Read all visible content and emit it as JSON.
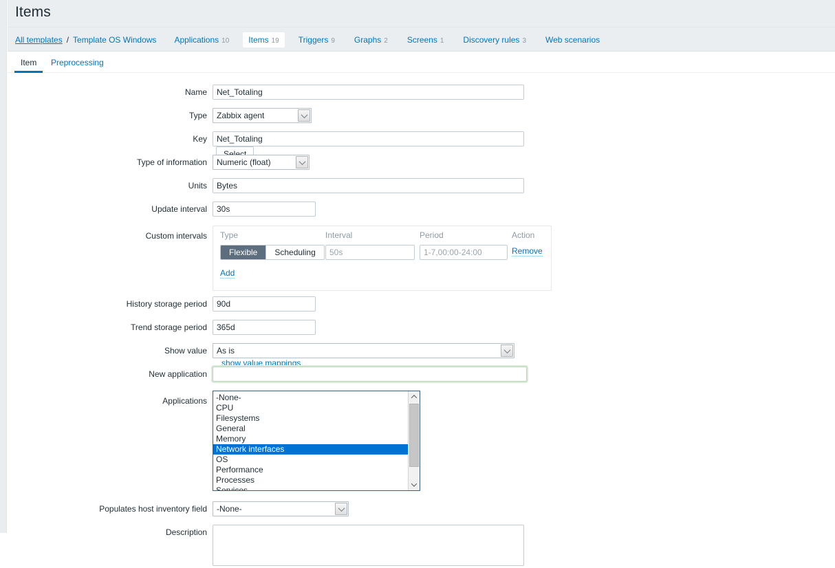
{
  "header": {
    "title": "Items"
  },
  "breadcrumb": {
    "all_templates": "All templates",
    "separator": "/",
    "template": "Template OS Windows"
  },
  "object_tabs": [
    {
      "label": "Applications",
      "count": "10",
      "active": false
    },
    {
      "label": "Items",
      "count": "19",
      "active": true
    },
    {
      "label": "Triggers",
      "count": "9",
      "active": false
    },
    {
      "label": "Graphs",
      "count": "2",
      "active": false
    },
    {
      "label": "Screens",
      "count": "1",
      "active": false
    },
    {
      "label": "Discovery rules",
      "count": "3",
      "active": false
    },
    {
      "label": "Web scenarios",
      "count": "",
      "active": false
    }
  ],
  "form_tabs": {
    "item": "Item",
    "preprocessing": "Preprocessing"
  },
  "labels": {
    "name": "Name",
    "type": "Type",
    "key": "Key",
    "type_of_information": "Type of information",
    "units": "Units",
    "update_interval": "Update interval",
    "custom_intervals": "Custom intervals",
    "history_storage_period": "History storage period",
    "trend_storage_period": "Trend storage period",
    "show_value": "Show value",
    "new_application": "New application",
    "applications": "Applications",
    "populates_host_inventory_field": "Populates host inventory field",
    "description": "Description"
  },
  "fields": {
    "name": "Net_Totaling",
    "type": "Zabbix agent",
    "key": "Net_Totaling",
    "key_select_button": "Select",
    "type_of_information": "Numeric (float)",
    "units": "Bytes",
    "update_interval": "30s",
    "history_storage_period": "90d",
    "trend_storage_period": "365d",
    "show_value": "As is",
    "show_value_mappings_link": "show value mappings",
    "new_application": "",
    "new_application_placeholder": "",
    "populates_host_inventory_field": "-None-",
    "description": ""
  },
  "custom_intervals": {
    "columns": {
      "type": "Type",
      "interval": "Interval",
      "period": "Period",
      "action": "Action"
    },
    "row": {
      "type_flexible": "Flexible",
      "type_scheduling": "Scheduling",
      "selected_type": "Flexible",
      "interval_value": "",
      "interval_placeholder": "50s",
      "period_value": "",
      "period_placeholder": "1-7,00:00-24:00",
      "remove_label": "Remove"
    },
    "add_label": "Add"
  },
  "applications_list": {
    "options": [
      "-None-",
      "CPU",
      "Filesystems",
      "General",
      "Memory",
      "Network interfaces",
      "OS",
      "Performance",
      "Processes",
      "Services"
    ],
    "selected": [
      "Network interfaces"
    ]
  },
  "colors": {
    "accent_link": "#0275b8",
    "header_bg": "#eaeef1",
    "selected_option_bg": "#0072d4",
    "segment_on_bg": "#5d6f7e",
    "focus_green": "#b6d8b9"
  }
}
